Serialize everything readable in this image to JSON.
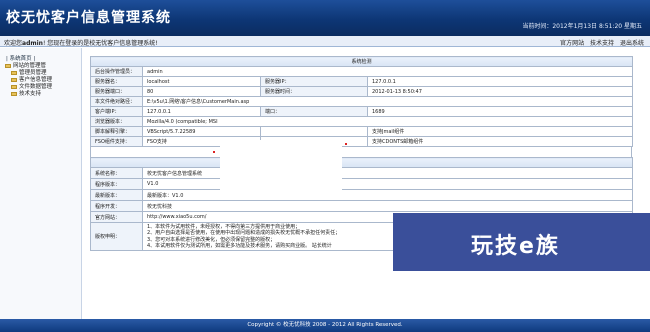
{
  "header": {
    "title": "校无忧客户信息管理系统",
    "time": "当前时间：2012年1月13日  8:51:20 星期五"
  },
  "welcome": {
    "prefix": "欢迎您",
    "user": "admin",
    "suffix": "! 您现在登录的是校无忧客户信息管理系统!",
    "links": [
      "官方网站",
      "技术支持",
      "退出系统"
    ]
  },
  "sidebar": {
    "home": "| 系统首页 |",
    "tree": [
      "网站的管理管",
      "管理员管理",
      "客户信息管理",
      "文件数据管理",
      "技术支持"
    ]
  },
  "detect": {
    "caption": "系统检测",
    "rows": [
      {
        "l1": "后台操作管理员：",
        "v1": "admin"
      },
      {
        "l1": "服务器名：",
        "v1": "localhost",
        "l2": "服务器IP：",
        "v2": "127.0.0.1"
      },
      {
        "l1": "服务器端口：",
        "v1": "80",
        "l2": "服务器时间：",
        "v2": "2012-01-13 8:50:47"
      },
      {
        "l1": "本文件绝对路径：",
        "v1": "E:\\v5u\\1.网络\\客户信息\\CustomerMain.asp"
      },
      {
        "l1": "客户端IP：",
        "v1": "127.0.0.1",
        "l2": "端口：",
        "v2": "1689"
      },
      {
        "l1": "浏览器版本：",
        "v1": "Mozilla/4.0 (compatible; MSI"
      },
      {
        "l1": "脚本解释引擎：",
        "v1": "VBScript/5.7.22589",
        "l2": "",
        "v2": "支持Jmail组件"
      },
      {
        "l1": "FSO组件支持：",
        "v1": "FSO支持",
        "l2": "",
        "v2": "支持CDONTS邮箱组件"
      }
    ]
  },
  "version": {
    "rows": [
      {
        "l": "系统名称：",
        "v": "校无忧客户信息管理系统"
      },
      {
        "l": "程序版本：",
        "v": "V1.0"
      },
      {
        "l": "最新版本：",
        "v": "最新版本：V1.0"
      },
      {
        "l": "程序开发：",
        "v": "校无忧科技"
      },
      {
        "l": "官方网站：",
        "v": "http://www.xiao5u.com/"
      }
    ],
    "disclaimer_label": "版权申明：",
    "disclaimer": [
      "1、本软件为试用软件，未经授权，不得向第三方提供用于商业使用；",
      "2、用户自由选择是否使用，在使用中出现问题和造成的损失校无忧概不承担任何责任；",
      "3、您可对本系统进行修改美化，但必须保留完整的版权；",
      "4、本试用软件仅为测试所用，如需更多功能及技术服务，请购买商业版。 站长统计"
    ]
  },
  "footer": "Copyright © 校无忧科技  2008 - 2012 All Rights Reserved.",
  "watermark": "玩技e族"
}
